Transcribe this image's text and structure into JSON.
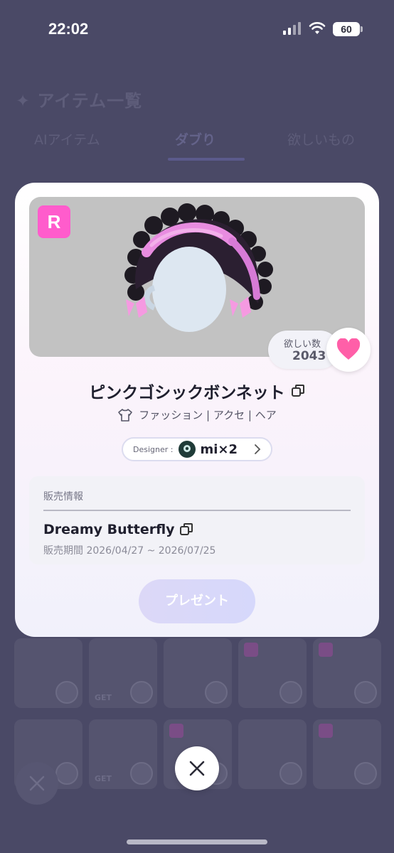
{
  "status_bar": {
    "time": "22:02",
    "battery": "60"
  },
  "background": {
    "title": "✦ アイテム一覧",
    "tabs": [
      "AIアイテム",
      "ダブり",
      "欲しいもの"
    ],
    "grid_get_label": "GET"
  },
  "item": {
    "rarity": "R",
    "want_label": "欲しい数",
    "want_count": "2043",
    "name": "ピンクゴシックボンネット",
    "category": "ファッション | アクセ | ヘア",
    "designer_label": "Designer :",
    "designer_name": "mi×2"
  },
  "sales": {
    "title": "販売情報",
    "event": "Dreamy Butterfly",
    "period": "販売期間 2026/04/27 ~ 2026/07/25"
  },
  "actions": {
    "present_label": "プレゼント"
  },
  "colors": {
    "accent_pink": "#ff5ccc",
    "heart_pink": "#ff5fa8"
  },
  "icons": [
    "copy-icon",
    "heart-icon",
    "shirt-icon",
    "chevron-right-icon",
    "close-icon"
  ]
}
